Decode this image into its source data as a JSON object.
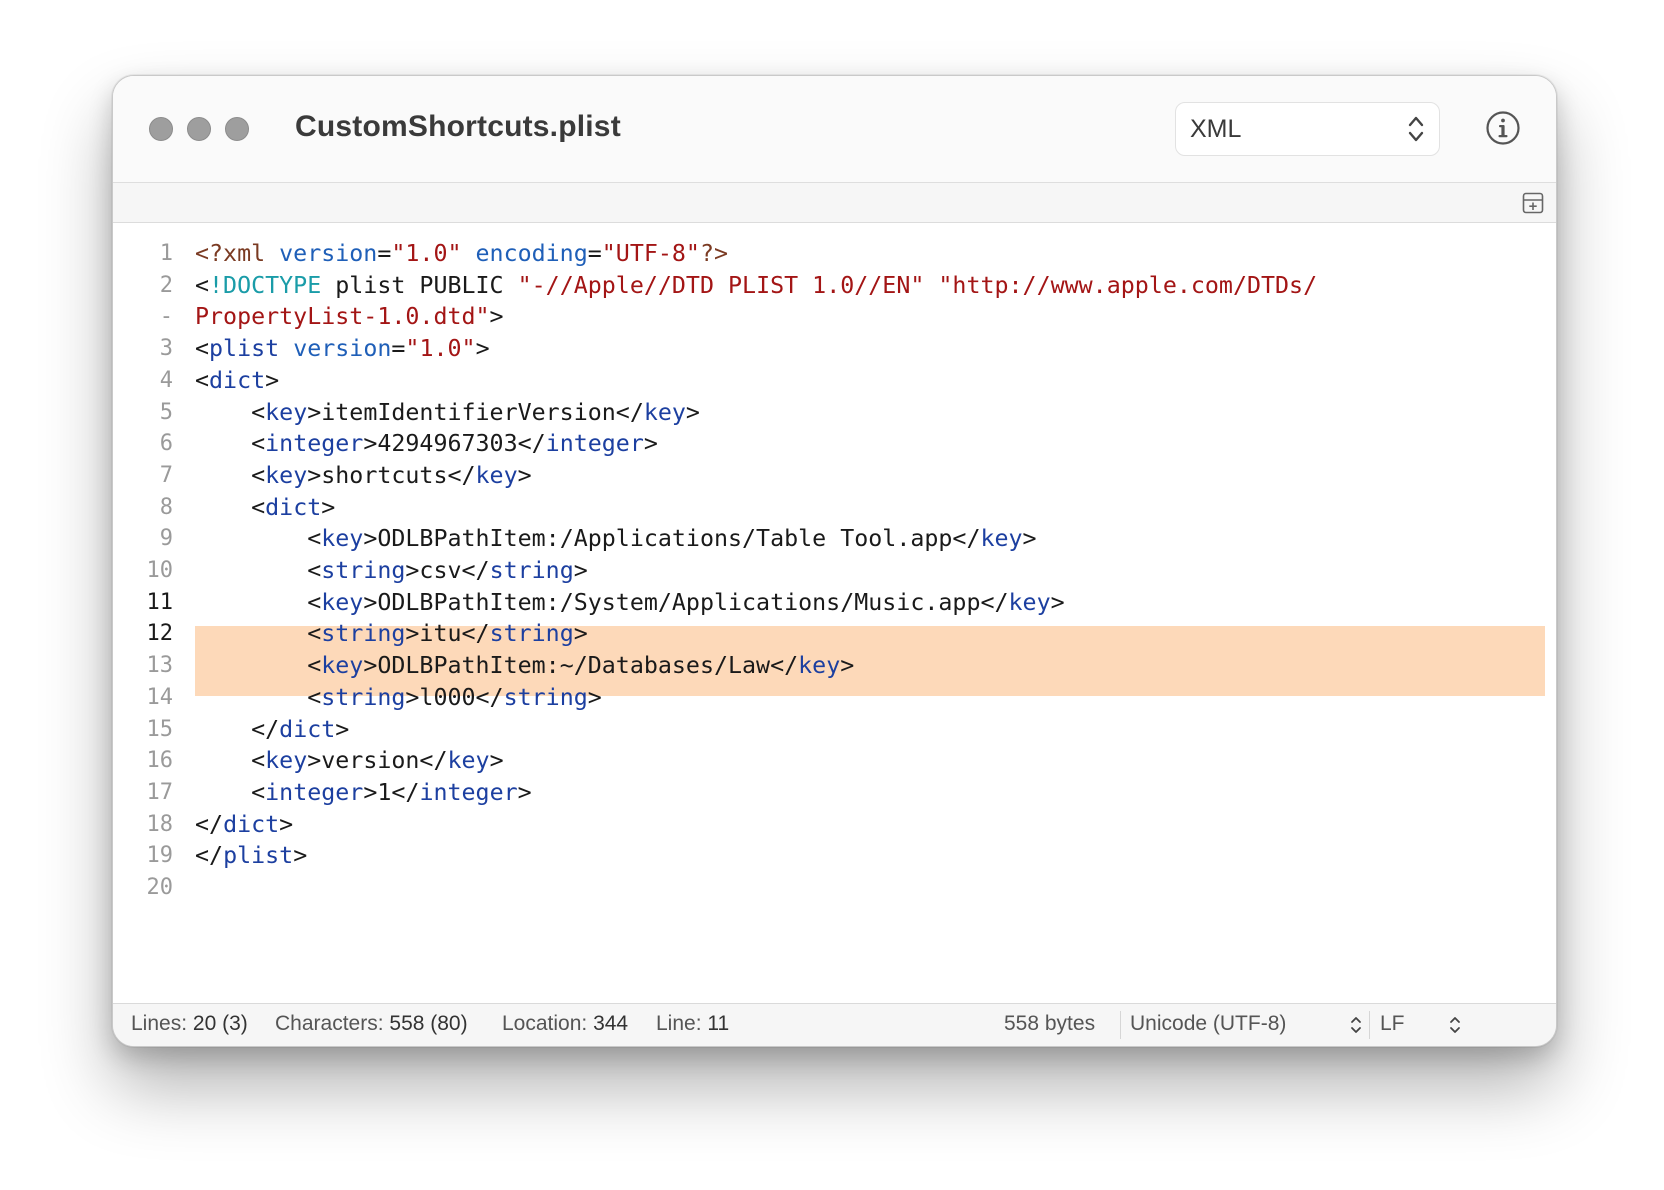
{
  "window": {
    "title": "CustomShortcuts.plist"
  },
  "toolbar": {
    "syntax_mode": "XML"
  },
  "editor": {
    "current_lines": [
      11,
      12
    ],
    "gutter": [
      {
        "label": "1"
      },
      {
        "label": "2"
      },
      {
        "label": "-"
      },
      {
        "label": "3"
      },
      {
        "label": "4"
      },
      {
        "label": "5"
      },
      {
        "label": "6"
      },
      {
        "label": "7"
      },
      {
        "label": "8"
      },
      {
        "label": "9"
      },
      {
        "label": "10"
      },
      {
        "label": "11"
      },
      {
        "label": "12"
      },
      {
        "label": "13"
      },
      {
        "label": "14"
      },
      {
        "label": "15"
      },
      {
        "label": "16"
      },
      {
        "label": "17"
      },
      {
        "label": "18"
      },
      {
        "label": "19"
      },
      {
        "label": "20"
      }
    ],
    "lines": [
      {
        "indent": 0,
        "tokens": [
          [
            "pi",
            "<?xml "
          ],
          [
            "attr",
            "version"
          ],
          [
            "txt",
            "="
          ],
          [
            "str",
            "\"1.0\" "
          ],
          [
            "attr",
            "encoding"
          ],
          [
            "txt",
            "="
          ],
          [
            "str",
            "\"UTF-8\""
          ],
          [
            "pi",
            "?>"
          ]
        ]
      },
      {
        "indent": 0,
        "tokens": [
          [
            "txt",
            "<"
          ],
          [
            "doctype",
            "!DOCTYPE"
          ],
          [
            "txt",
            " plist PUBLIC "
          ],
          [
            "str",
            "\"-//Apple//DTD PLIST 1.0//EN\" \"http://www.apple.com/DTDs/"
          ]
        ]
      },
      {
        "indent": 0,
        "tokens": [
          [
            "str",
            "PropertyList-1.0.dtd\""
          ],
          [
            "txt",
            ">"
          ]
        ]
      },
      {
        "indent": 0,
        "tokens": [
          [
            "txt",
            "<"
          ],
          [
            "tag",
            "plist"
          ],
          [
            "txt",
            " "
          ],
          [
            "attr",
            "version"
          ],
          [
            "txt",
            "="
          ],
          [
            "str",
            "\"1.0\""
          ],
          [
            "txt",
            ">"
          ]
        ]
      },
      {
        "indent": 0,
        "tokens": [
          [
            "txt",
            "<"
          ],
          [
            "tag",
            "dict"
          ],
          [
            "txt",
            ">"
          ]
        ]
      },
      {
        "indent": 1,
        "tokens": [
          [
            "txt",
            "<"
          ],
          [
            "tag",
            "key"
          ],
          [
            "txt",
            ">itemIdentifierVersion</"
          ],
          [
            "tag",
            "key"
          ],
          [
            "txt",
            ">"
          ]
        ]
      },
      {
        "indent": 1,
        "tokens": [
          [
            "txt",
            "<"
          ],
          [
            "tag",
            "integer"
          ],
          [
            "txt",
            ">4294967303</"
          ],
          [
            "tag",
            "integer"
          ],
          [
            "txt",
            ">"
          ]
        ]
      },
      {
        "indent": 1,
        "tokens": [
          [
            "txt",
            "<"
          ],
          [
            "tag",
            "key"
          ],
          [
            "txt",
            ">shortcuts</"
          ],
          [
            "tag",
            "key"
          ],
          [
            "txt",
            ">"
          ]
        ]
      },
      {
        "indent": 1,
        "tokens": [
          [
            "txt",
            "<"
          ],
          [
            "tag",
            "dict"
          ],
          [
            "txt",
            ">"
          ]
        ]
      },
      {
        "indent": 2,
        "tokens": [
          [
            "txt",
            "<"
          ],
          [
            "tag",
            "key"
          ],
          [
            "txt",
            ">ODLBPathItem:/Applications/Table Tool.app</"
          ],
          [
            "tag",
            "key"
          ],
          [
            "txt",
            ">"
          ]
        ]
      },
      {
        "indent": 2,
        "tokens": [
          [
            "txt",
            "<"
          ],
          [
            "tag",
            "string"
          ],
          [
            "txt",
            ">csv</"
          ],
          [
            "tag",
            "string"
          ],
          [
            "txt",
            ">"
          ]
        ]
      },
      {
        "indent": 2,
        "tokens": [
          [
            "txt",
            "<"
          ],
          [
            "tag",
            "key"
          ],
          [
            "txt",
            ">ODLBPathItem:/System/Applications/Music.app</"
          ],
          [
            "tag",
            "key"
          ],
          [
            "txt",
            ">"
          ]
        ]
      },
      {
        "indent": 2,
        "tokens": [
          [
            "txt",
            "<"
          ],
          [
            "tag",
            "string"
          ],
          [
            "txt",
            ">itu</"
          ],
          [
            "tag",
            "string"
          ],
          [
            "txt",
            ">"
          ]
        ]
      },
      {
        "indent": 2,
        "tokens": [
          [
            "txt",
            "<"
          ],
          [
            "tag",
            "key"
          ],
          [
            "txt",
            ">ODLBPathItem:~/Databases/Law</"
          ],
          [
            "tag",
            "key"
          ],
          [
            "txt",
            ">"
          ]
        ]
      },
      {
        "indent": 2,
        "tokens": [
          [
            "txt",
            "<"
          ],
          [
            "tag",
            "string"
          ],
          [
            "txt",
            ">l000</"
          ],
          [
            "tag",
            "string"
          ],
          [
            "txt",
            ">"
          ]
        ]
      },
      {
        "indent": 1,
        "tokens": [
          [
            "txt",
            "</"
          ],
          [
            "tag",
            "dict"
          ],
          [
            "txt",
            ">"
          ]
        ]
      },
      {
        "indent": 1,
        "tokens": [
          [
            "txt",
            "<"
          ],
          [
            "tag",
            "key"
          ],
          [
            "txt",
            ">version</"
          ],
          [
            "tag",
            "key"
          ],
          [
            "txt",
            ">"
          ]
        ]
      },
      {
        "indent": 1,
        "tokens": [
          [
            "txt",
            "<"
          ],
          [
            "tag",
            "integer"
          ],
          [
            "txt",
            ">1</"
          ],
          [
            "tag",
            "integer"
          ],
          [
            "txt",
            ">"
          ]
        ]
      },
      {
        "indent": 0,
        "tokens": [
          [
            "txt",
            "</"
          ],
          [
            "tag",
            "dict"
          ],
          [
            "txt",
            ">"
          ]
        ]
      },
      {
        "indent": 0,
        "tokens": [
          [
            "txt",
            "</"
          ],
          [
            "tag",
            "plist"
          ],
          [
            "txt",
            ">"
          ]
        ]
      },
      {
        "indent": 0,
        "tokens": []
      }
    ]
  },
  "status": {
    "lines_label": "Lines:",
    "lines_value": "20 (3)",
    "chars_label": "Characters:",
    "chars_value": "558 (80)",
    "location_label": "Location:",
    "location_value": "344",
    "line_label": "Line:",
    "line_value": "11",
    "file_size": "558 bytes",
    "encoding": "Unicode (UTF-8)",
    "line_ending": "LF"
  },
  "colors": {
    "tag": "#1c3fa0",
    "attribute": "#1f5fb8",
    "string": "#a31515",
    "processing_instruction": "#7a3a22",
    "doctype": "#1a9ca8",
    "selection": "#fdd9b9"
  },
  "icons": {
    "syntax_chevron": "up-down-chevron-icon",
    "info": "info-circle-icon",
    "split": "split-editor-icon"
  }
}
